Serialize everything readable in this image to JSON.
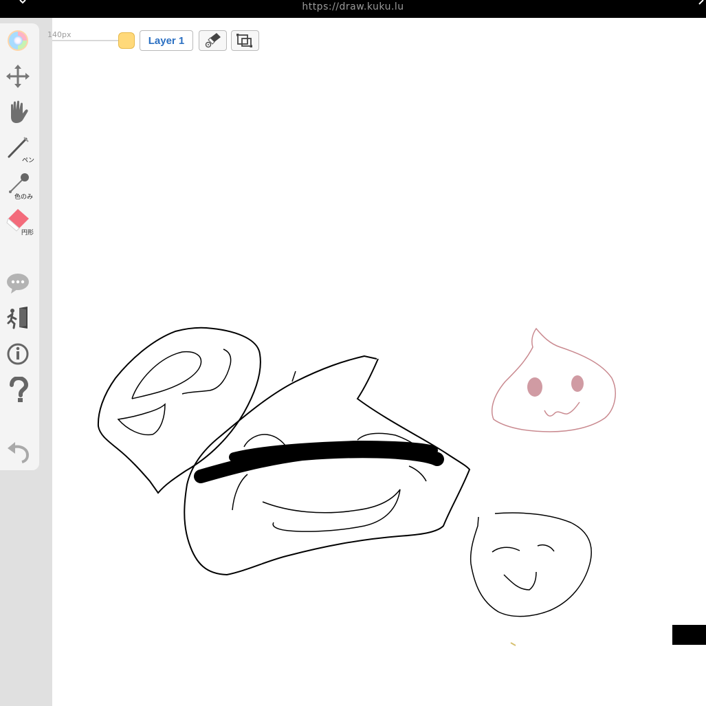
{
  "browser": {
    "url": "https://draw.kuku.lu"
  },
  "toolbar": {
    "brush_size": "140px",
    "layer_label": "Layer 1",
    "current_color": "#ffd97a"
  },
  "tools": {
    "pen_caption": "ペン",
    "eyedropper_caption": "色のみ",
    "eraser_caption": "円形"
  },
  "colors": {
    "ink": "#000000",
    "pink_ink": "#c9898f",
    "eraser": "#f36b7b",
    "layer_text": "#2a6fc2"
  }
}
